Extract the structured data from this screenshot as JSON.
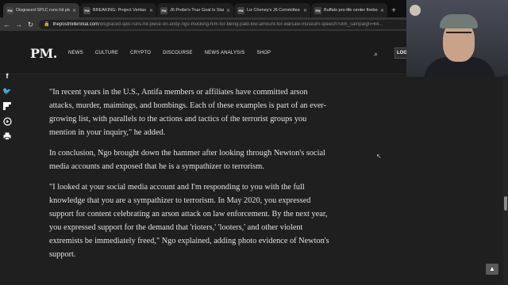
{
  "tabs": [
    {
      "favicon": "PM",
      "title": "Disgraced SPLC runs hit piece o",
      "active": true
    },
    {
      "favicon": "PM",
      "title": "BREAKING: Project Veritas expos",
      "active": false
    },
    {
      "favicon": "PM",
      "title": "J6 Probe's True Goal Is Slanderin",
      "active": false
    },
    {
      "favicon": "PM",
      "title": "Liz Cheney's J6 Committee Wan",
      "active": false
    },
    {
      "favicon": "PM",
      "title": "Buffalo pro-life center firebomb",
      "active": false
    }
  ],
  "address": {
    "domain": "thepostmillennial.com",
    "path": "/disgraced-splc-runs-hit-piece-on-andy-ngo-mocking-him-for-being-paid-low-amount-for-warsaw-museum-speech?utm_campaign=64..."
  },
  "site": {
    "logo": "PM.",
    "menu": [
      "NEWS",
      "CULTURE",
      "CRYPTO",
      "DISCOURSE",
      "NEWS ANALYSIS",
      "SHOP"
    ],
    "login_label": "LOG"
  },
  "share_icons": [
    "facebook-icon",
    "twitter-icon",
    "flipboard-icon",
    "share-icon",
    "print-icon"
  ],
  "article": {
    "paragraphs": [
      "\"In recent years in the U.S., Antifa members or affiliates have committed arson attacks, murder, maimings, and bombings. Each of these examples is part of an ever-growing list, with parallels to the actions and tactics of the terrorist groups you mention in your inquiry,\" he added.",
      "In conclusion, Ngo brought down the hammer after looking through Newton's social media accounts and exposed that he is a sympathizer to terrorism.",
      "\"I looked at your social media account and I'm responding to you with the full knowledge that you are a sympathizer to terrorism. In May 2020, you expressed support for content celebrating an arson attack on law enforcement. By the next year, you expressed support for the demand that 'rioters,' 'looters,' and other violent extremists be immediately freed,\" Ngo explained, adding photo evidence of Newton's support."
    ]
  }
}
